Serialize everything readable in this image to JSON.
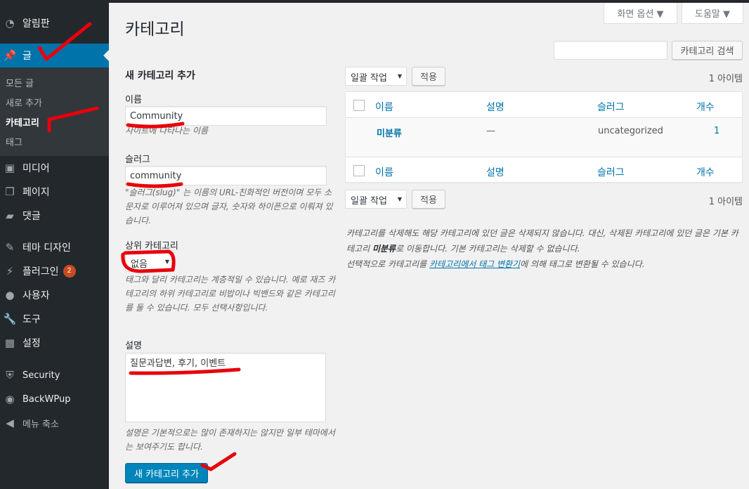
{
  "sidebar": {
    "dashboard": "알림판",
    "posts": "글",
    "sub_all": "모든 글",
    "sub_new": "새로 추가",
    "sub_categories": "카테고리",
    "sub_tags": "태그",
    "media": "미디어",
    "pages": "페이지",
    "comments": "댓글",
    "appearance": "테마 디자인",
    "plugins": "플러그인",
    "plugins_badge": "2",
    "users": "사용자",
    "tools": "도구",
    "settings": "설정",
    "security": "Security",
    "backwpup": "BackWPup",
    "collapse": "메뉴 축소"
  },
  "header": {
    "title": "카테고리",
    "screen_options": "화면 옵션 ▼",
    "help": "도움말 ▼",
    "search_button": "카테고리 검색"
  },
  "form": {
    "heading": "새 카테고리 추가",
    "name_label": "이름",
    "name_value": "Community",
    "name_help": "사이트에 나타나는 이름",
    "slug_label": "슬러그",
    "slug_value": "community",
    "slug_help": "\"슬러그(slug)\" 는 이름의 URL-친화적인 버전이며 모두 소문자로 이루어져 있으며 글자, 숫자와 하이픈으로 이뤄져 있습니다.",
    "parent_label": "상위 카테고리",
    "parent_value": "없음",
    "parent_help": "태그와 달리 카테고리는 계층적일 수 있습니다. 예로 재즈 카테고리의 하위 카테고리로 비밥이나 빅밴드와 같은 카테고리를 둘 수 있습니다. 모두 선택사항입니다.",
    "desc_label": "설명",
    "desc_value": "질문과답변, 후기, 이벤트",
    "desc_help": "설명은 기본적으로는 많이 존재하지는 않지만 일부 테마에서는 보여주기도 합니다.",
    "submit": "새 카테고리 추가"
  },
  "list": {
    "bulk_action": "일괄 작업",
    "apply": "적용",
    "item_count": "1 아이템",
    "columns": [
      "이름",
      "설명",
      "슬러그",
      "개수"
    ],
    "rows": [
      {
        "name": "미분류",
        "description": "—",
        "slug": "uncategorized",
        "count": "1"
      }
    ]
  },
  "notes": {
    "line1_a": "카테고리를 삭제해도 해당 카테고리에 있던 글은 삭제되지 않습니다. 대신, 삭제된 카테고리에 있던 글은 기본 카테고리 ",
    "line1_bold": "미분류",
    "line1_b": "로 이동합니다. 기본 카테고리는 삭제할 수 없습니다.",
    "line2_a": "선택적으로 카테고리를 ",
    "line2_link": "카테고리에서 태그 변환기",
    "line2_b": "에 의해 태그로 변환될 수 있습니다."
  },
  "colors": {
    "sidebar_bg": "#23282d",
    "accent": "#0073aa",
    "annotation_red": "#e8000b"
  }
}
